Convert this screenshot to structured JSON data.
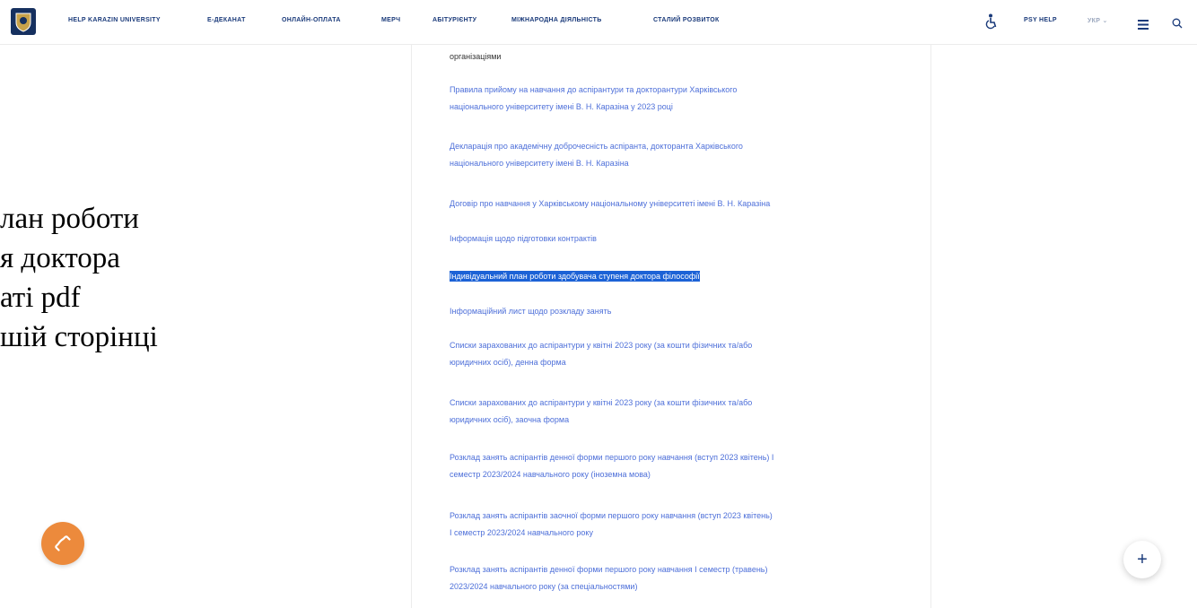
{
  "nav": {
    "items": [
      {
        "label": "HELP KARAZIN UNIVERSITY"
      },
      {
        "label": "E-ДЕКАНАТ"
      },
      {
        "label": "ОНЛАЙН-ОПЛАТА"
      },
      {
        "label": "МЕРЧ"
      },
      {
        "label": "АБІТУРІЄНТУ"
      },
      {
        "label": "МІЖНАРОДНА ДІЯЛЬНІСТЬ"
      },
      {
        "label": "СТАЛИЙ РОЗВИТОК"
      }
    ],
    "psy_help": "PSY HELP",
    "language": "УКР ⌄",
    "icons": {
      "accessibility": "accessibility-icon",
      "menu": "menu-icon",
      "search": "search-icon"
    }
  },
  "overlay": {
    "lines": [
      "лан роботи",
      "я доктора",
      "аті pdf",
      "шій сторінці"
    ]
  },
  "content": {
    "intro": "організаціями",
    "links": [
      {
        "lines": [
          "Правила прийому на навчання до аспірантури та докторантури Харківського",
          "національного університету імені В. Н. Каразіна у 2023 році"
        ]
      },
      {
        "lines": [
          "Декларація про академічну доброчесність аспіранта, докторанта Харківського",
          "національного університету імені В. Н. Каразіна"
        ]
      },
      {
        "lines": [
          "Договір про навчання у Харківському національному університеті імені В. Н. Каразіна"
        ]
      },
      {
        "lines": [
          "Інформація щодо підготовки контрактів"
        ]
      },
      {
        "lines": [
          "Індивідуальний план роботи здобувача ступеня доктора філософії"
        ],
        "selected": true
      },
      {
        "lines": [
          "Інформаційний лист щодо розкладу занять"
        ]
      },
      {
        "lines": [
          "Списки зарахованих до аспірантури у квітні 2023 року (за кошти фізичних та/або",
          "юридичних осіб), денна форма"
        ]
      },
      {
        "lines": [
          "Списки зарахованих до аспірантури у квітні 2023 року (за кошти фізичних та/або",
          "юридичних осіб), заочна форма"
        ]
      },
      {
        "lines": [
          "Розклад занять аспірантів денної форми першого року навчання (вступ 2023 квітень) І",
          "семестр 2023/2024 навчального року (іноземна мова)"
        ]
      },
      {
        "lines": [
          "Розклад занять аспірантів заочної форми першого року навчання (вступ 2023 квітень)",
          "І семестр 2023/2024 навчального року"
        ]
      },
      {
        "lines": [
          "Розклад занять аспірантів денної форми першого року навчання І семестр (травень)",
          "2023/2024 навчального року (за спеціальностями)"
        ]
      }
    ]
  },
  "floating": {
    "phone_icon": "phone-icon",
    "plus_label": "+"
  },
  "colors": {
    "link": "#4d6fd9",
    "nav": "#1a3a7a",
    "selection": "#1c62d6",
    "phone_button": "#ec8a3c"
  }
}
